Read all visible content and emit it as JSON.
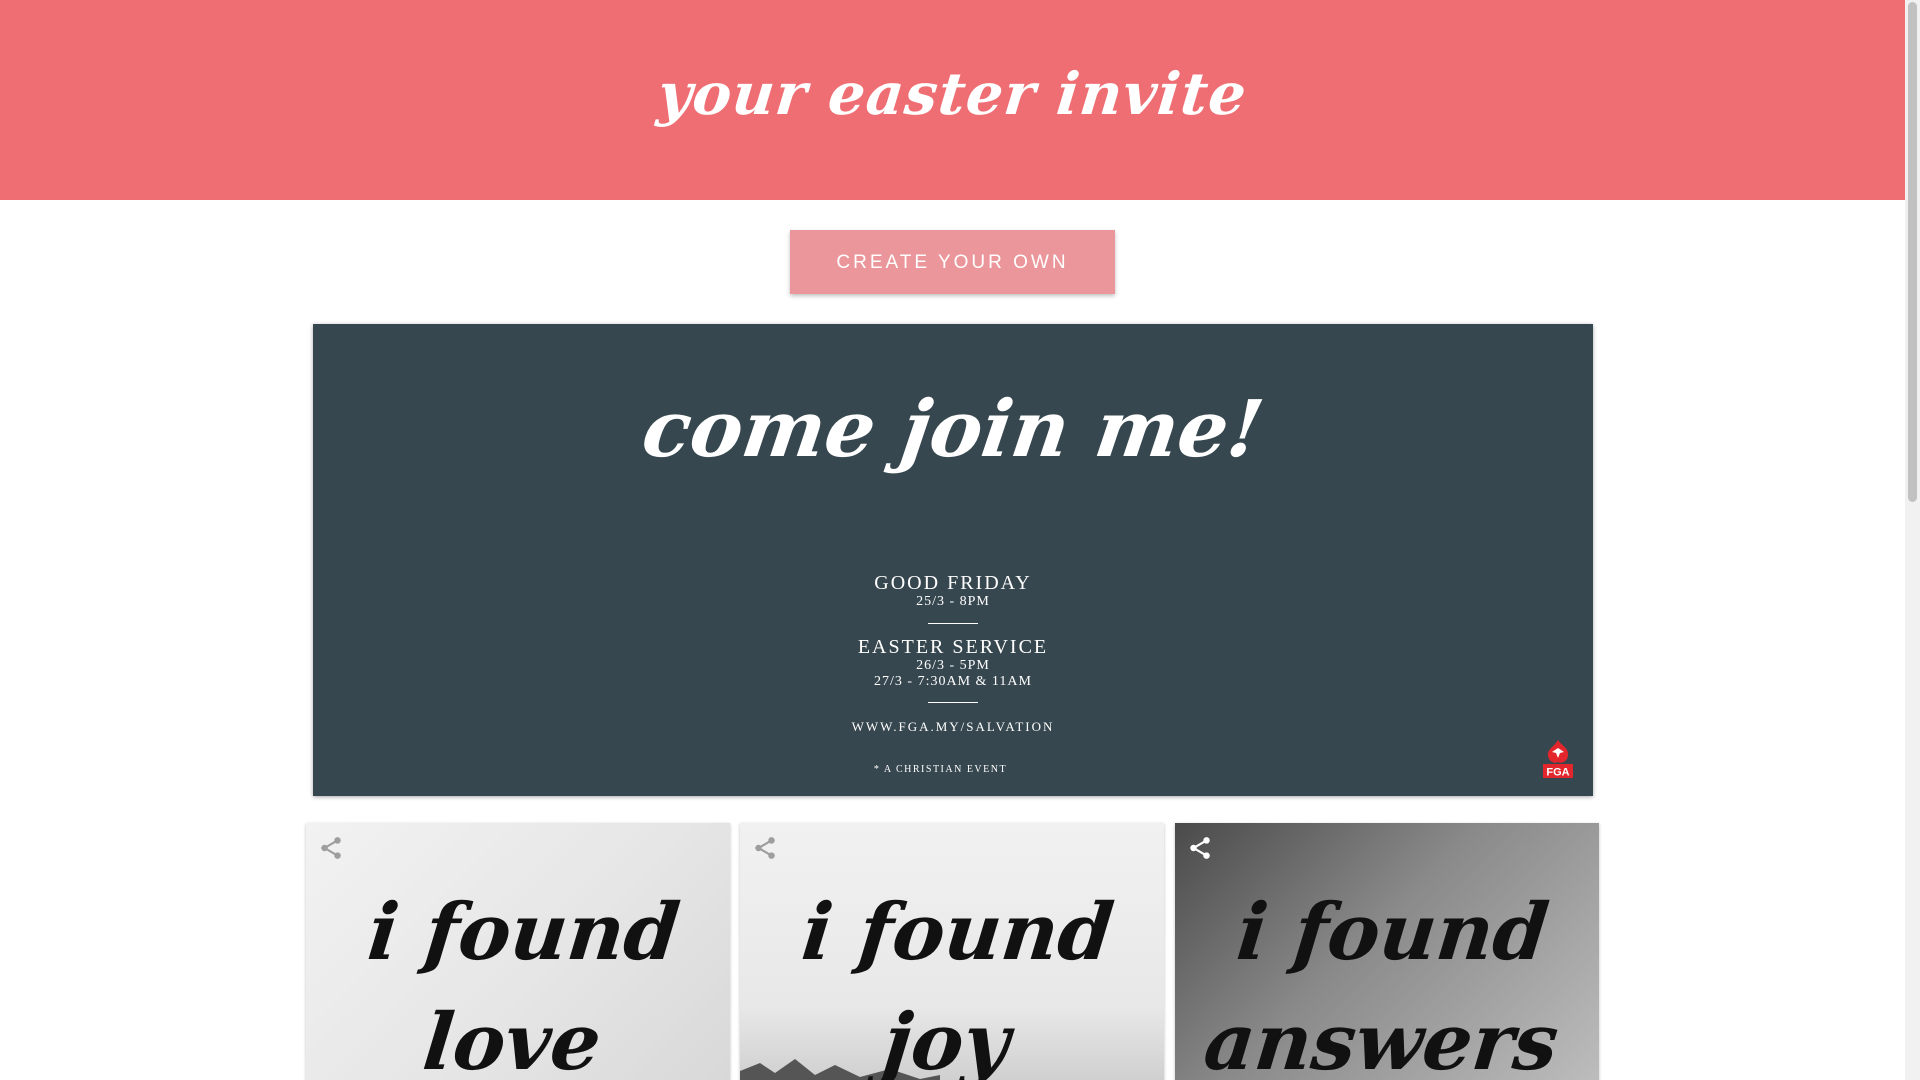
{
  "header": {
    "title": "your easter invite"
  },
  "actions": {
    "create_label": "CREATE YOUR OWN"
  },
  "invite": {
    "title": "come join me!",
    "events": [
      {
        "name": "GOOD FRIDAY",
        "times": [
          "25/3 - 8PM"
        ]
      },
      {
        "name": "EASTER SERVICE",
        "times": [
          "26/3 - 5PM",
          "27/3 - 7:30AM & 11AM"
        ]
      }
    ],
    "website": "WWW.FGA.MY/SALVATION",
    "disclaimer": "* A CHRISTIAN EVENT",
    "logo_text": "FGA"
  },
  "gallery": [
    {
      "line1": "i found",
      "line2": "love"
    },
    {
      "line1": "i found",
      "line2": "joy"
    },
    {
      "line1": "i found",
      "line2": "answers"
    }
  ],
  "colors": {
    "header_bg": "#ef6e73",
    "button_bg": "#ea969a",
    "card_bg": "#37474f",
    "logo_red": "#e2262b"
  },
  "icons": {
    "share": "share-icon",
    "logo": "fga-logo"
  }
}
